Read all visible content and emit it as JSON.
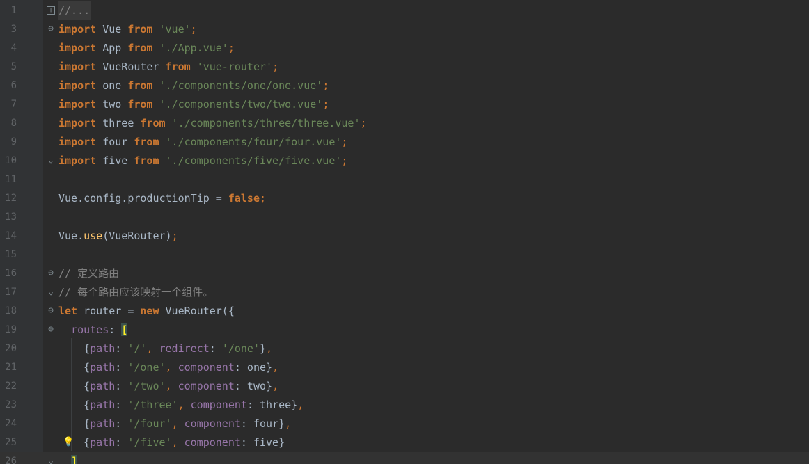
{
  "editor": {
    "colors": {
      "background": "#2b2b2b",
      "gutter": "#313335",
      "line_number": "#606366",
      "keyword": "#cc7832",
      "string": "#6a8759",
      "comment": "#808080",
      "property": "#9876aa",
      "function": "#ffc66d",
      "identifier": "#a9b7c6"
    },
    "lines": [
      {
        "num": "1",
        "fold": "plus",
        "folded": true,
        "tokens": [
          {
            "t": "//...",
            "c": "cmt"
          }
        ]
      },
      {
        "num": "3",
        "fold": "open",
        "tokens": [
          {
            "t": "import",
            "c": "kw"
          },
          {
            "t": " Vue ",
            "c": ""
          },
          {
            "t": "from",
            "c": "kw"
          },
          {
            "t": " ",
            "c": ""
          },
          {
            "t": "'vue'",
            "c": "str"
          },
          {
            "t": ";",
            "c": "semi"
          }
        ]
      },
      {
        "num": "4",
        "tokens": [
          {
            "t": "import",
            "c": "kw"
          },
          {
            "t": " App ",
            "c": ""
          },
          {
            "t": "from",
            "c": "kw"
          },
          {
            "t": " ",
            "c": ""
          },
          {
            "t": "'./App.vue'",
            "c": "str"
          },
          {
            "t": ";",
            "c": "semi"
          }
        ]
      },
      {
        "num": "5",
        "tokens": [
          {
            "t": "import",
            "c": "kw"
          },
          {
            "t": " VueRouter ",
            "c": ""
          },
          {
            "t": "from",
            "c": "kw"
          },
          {
            "t": " ",
            "c": ""
          },
          {
            "t": "'vue-router'",
            "c": "str"
          },
          {
            "t": ";",
            "c": "semi"
          }
        ]
      },
      {
        "num": "6",
        "tokens": [
          {
            "t": "import",
            "c": "kw"
          },
          {
            "t": " one ",
            "c": ""
          },
          {
            "t": "from",
            "c": "kw"
          },
          {
            "t": " ",
            "c": ""
          },
          {
            "t": "'./components/one/one.vue'",
            "c": "str"
          },
          {
            "t": ";",
            "c": "semi"
          }
        ]
      },
      {
        "num": "7",
        "tokens": [
          {
            "t": "import",
            "c": "kw"
          },
          {
            "t": " two ",
            "c": ""
          },
          {
            "t": "from",
            "c": "kw"
          },
          {
            "t": " ",
            "c": ""
          },
          {
            "t": "'./components/two/two.vue'",
            "c": "str"
          },
          {
            "t": ";",
            "c": "semi"
          }
        ]
      },
      {
        "num": "8",
        "tokens": [
          {
            "t": "import",
            "c": "kw"
          },
          {
            "t": " three ",
            "c": ""
          },
          {
            "t": "from",
            "c": "kw"
          },
          {
            "t": " ",
            "c": ""
          },
          {
            "t": "'./components/three/three.vue'",
            "c": "str"
          },
          {
            "t": ";",
            "c": "semi"
          }
        ]
      },
      {
        "num": "9",
        "tokens": [
          {
            "t": "import",
            "c": "kw"
          },
          {
            "t": " four ",
            "c": ""
          },
          {
            "t": "from",
            "c": "kw"
          },
          {
            "t": " ",
            "c": ""
          },
          {
            "t": "'./components/four/four.vue'",
            "c": "str"
          },
          {
            "t": ";",
            "c": "semi"
          }
        ]
      },
      {
        "num": "10",
        "fold": "close",
        "tokens": [
          {
            "t": "import",
            "c": "kw"
          },
          {
            "t": " five ",
            "c": ""
          },
          {
            "t": "from",
            "c": "kw"
          },
          {
            "t": " ",
            "c": ""
          },
          {
            "t": "'./components/five/five.vue'",
            "c": "str"
          },
          {
            "t": ";",
            "c": "semi"
          }
        ]
      },
      {
        "num": "11",
        "tokens": []
      },
      {
        "num": "12",
        "tokens": [
          {
            "t": "Vue.config.productionTip = ",
            "c": ""
          },
          {
            "t": "false",
            "c": "kw"
          },
          {
            "t": ";",
            "c": "semi"
          }
        ]
      },
      {
        "num": "13",
        "tokens": []
      },
      {
        "num": "14",
        "tokens": [
          {
            "t": "Vue.",
            "c": ""
          },
          {
            "t": "use",
            "c": "fn"
          },
          {
            "t": "(VueRouter)",
            "c": ""
          },
          {
            "t": ";",
            "c": "semi"
          }
        ]
      },
      {
        "num": "15",
        "tokens": []
      },
      {
        "num": "16",
        "fold": "open",
        "tokens": [
          {
            "t": "// 定义路由",
            "c": "cmt"
          }
        ]
      },
      {
        "num": "17",
        "fold": "close",
        "tokens": [
          {
            "t": "// 每个路由应该映射一个组件。",
            "c": "cmt"
          }
        ]
      },
      {
        "num": "18",
        "fold": "open",
        "tokens": [
          {
            "t": "let",
            "c": "kw"
          },
          {
            "t": " router = ",
            "c": ""
          },
          {
            "t": "new",
            "c": "kw"
          },
          {
            "t": " VueRouter({",
            "c": ""
          }
        ]
      },
      {
        "num": "19",
        "fold": "open",
        "tokens": [
          {
            "t": "  ",
            "c": ""
          },
          {
            "t": "routes",
            "c": "prop"
          },
          {
            "t": ": ",
            "c": ""
          },
          {
            "t": "[",
            "c": "br-hl"
          }
        ]
      },
      {
        "num": "20",
        "tokens": [
          {
            "t": "    {",
            "c": ""
          },
          {
            "t": "path",
            "c": "prop"
          },
          {
            "t": ": ",
            "c": ""
          },
          {
            "t": "'/'",
            "c": "str"
          },
          {
            "t": ", ",
            "c": "semi"
          },
          {
            "t": "redirect",
            "c": "prop"
          },
          {
            "t": ": ",
            "c": ""
          },
          {
            "t": "'/one'",
            "c": "str"
          },
          {
            "t": "}",
            "c": ""
          },
          {
            "t": ",",
            "c": "semi"
          }
        ]
      },
      {
        "num": "21",
        "tokens": [
          {
            "t": "    {",
            "c": ""
          },
          {
            "t": "path",
            "c": "prop"
          },
          {
            "t": ": ",
            "c": ""
          },
          {
            "t": "'/one'",
            "c": "str"
          },
          {
            "t": ", ",
            "c": "semi"
          },
          {
            "t": "component",
            "c": "prop"
          },
          {
            "t": ": one}",
            "c": ""
          },
          {
            "t": ",",
            "c": "semi"
          }
        ]
      },
      {
        "num": "22",
        "tokens": [
          {
            "t": "    {",
            "c": ""
          },
          {
            "t": "path",
            "c": "prop"
          },
          {
            "t": ": ",
            "c": ""
          },
          {
            "t": "'/two'",
            "c": "str"
          },
          {
            "t": ", ",
            "c": "semi"
          },
          {
            "t": "component",
            "c": "prop"
          },
          {
            "t": ": two}",
            "c": ""
          },
          {
            "t": ",",
            "c": "semi"
          }
        ]
      },
      {
        "num": "23",
        "tokens": [
          {
            "t": "    {",
            "c": ""
          },
          {
            "t": "path",
            "c": "prop"
          },
          {
            "t": ": ",
            "c": ""
          },
          {
            "t": "'/three'",
            "c": "str"
          },
          {
            "t": ", ",
            "c": "semi"
          },
          {
            "t": "component",
            "c": "prop"
          },
          {
            "t": ": three}",
            "c": ""
          },
          {
            "t": ",",
            "c": "semi"
          }
        ]
      },
      {
        "num": "24",
        "tokens": [
          {
            "t": "    {",
            "c": ""
          },
          {
            "t": "path",
            "c": "prop"
          },
          {
            "t": ": ",
            "c": ""
          },
          {
            "t": "'/four'",
            "c": "str"
          },
          {
            "t": ", ",
            "c": "semi"
          },
          {
            "t": "component",
            "c": "prop"
          },
          {
            "t": ": four}",
            "c": ""
          },
          {
            "t": ",",
            "c": "semi"
          }
        ]
      },
      {
        "num": "25",
        "bulb": true,
        "tokens": [
          {
            "t": "    {",
            "c": ""
          },
          {
            "t": "path",
            "c": "prop"
          },
          {
            "t": ": ",
            "c": ""
          },
          {
            "t": "'/five'",
            "c": "str"
          },
          {
            "t": ", ",
            "c": "semi"
          },
          {
            "t": "component",
            "c": "prop"
          },
          {
            "t": ": five}",
            "c": ""
          }
        ]
      },
      {
        "num": "26",
        "fold": "close",
        "current": true,
        "tokens": [
          {
            "t": "  ",
            "c": ""
          },
          {
            "t": "]",
            "c": "br-hl"
          }
        ]
      }
    ]
  }
}
